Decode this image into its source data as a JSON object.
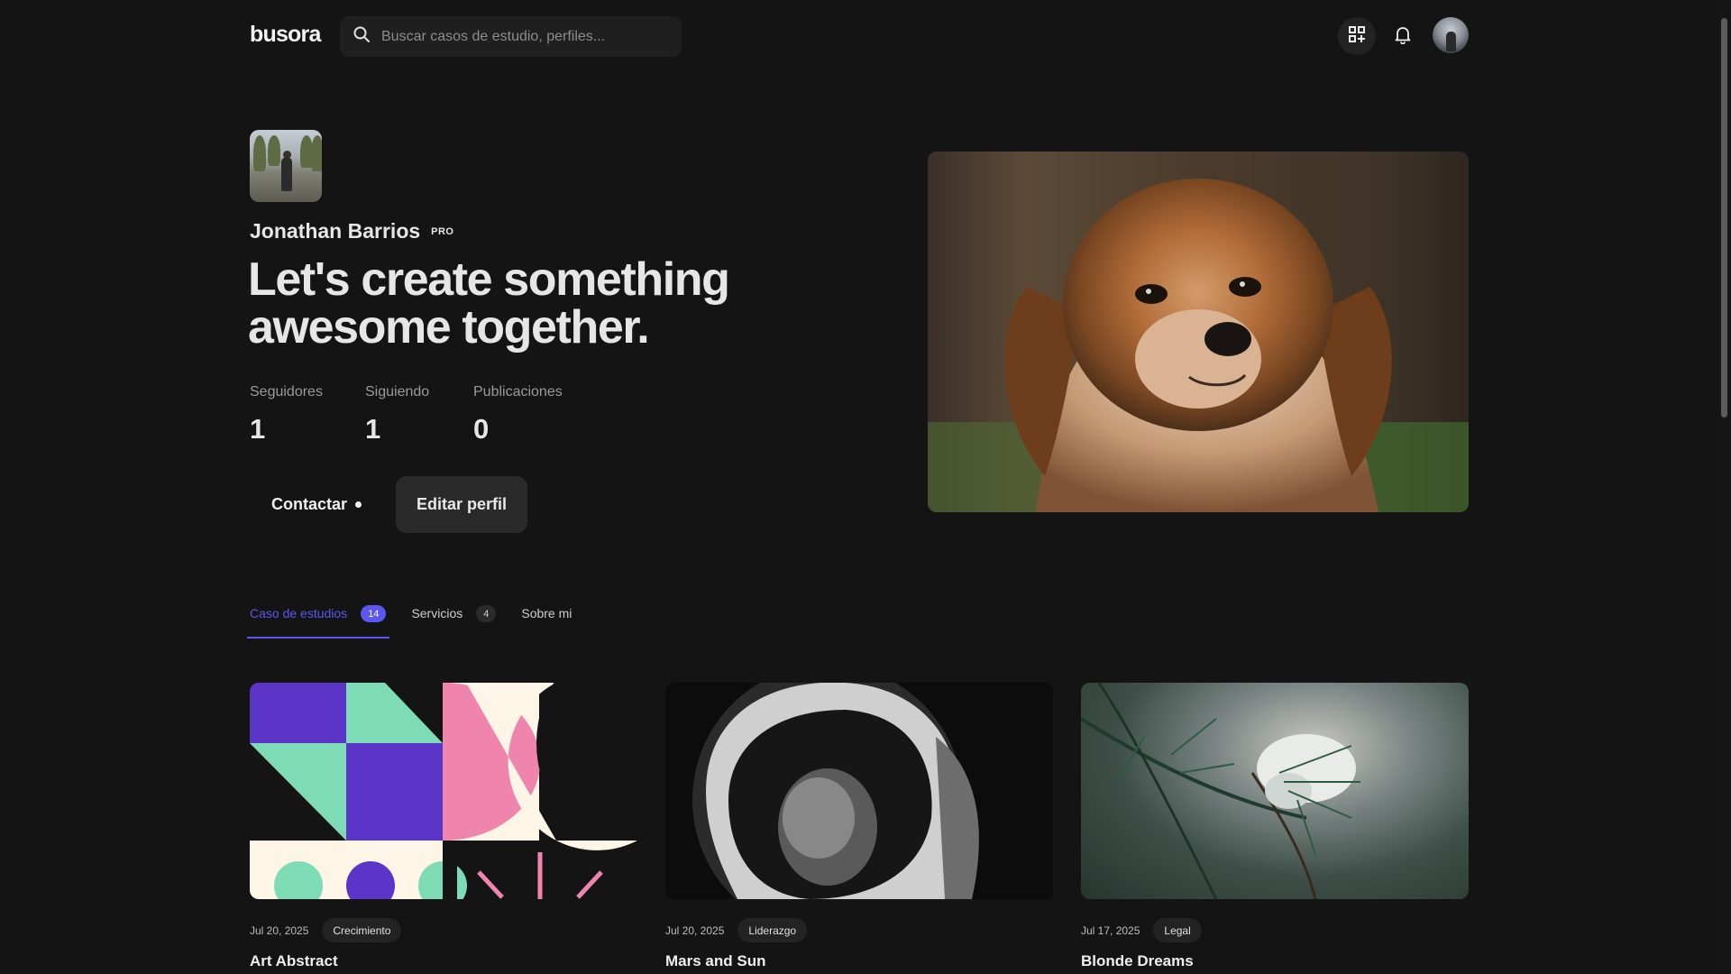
{
  "header": {
    "logo": "busora",
    "search_placeholder": "Buscar casos de estudio, perfiles...",
    "icons": [
      "search-icon",
      "apps-add-icon",
      "bell-icon",
      "user-avatar"
    ]
  },
  "profile": {
    "name": "Jonathan Barrios",
    "badge": "PRO",
    "headline": "Let's create something awesome together.",
    "stats": [
      {
        "label": "Seguidores",
        "value": "1"
      },
      {
        "label": "Siguiendo",
        "value": "1"
      },
      {
        "label": "Publicaciones",
        "value": "0"
      }
    ],
    "contact_label": "Contactar",
    "edit_label": "Editar perfil"
  },
  "tabs": [
    {
      "label": "Caso de estudios",
      "count": "14",
      "active": true
    },
    {
      "label": "Servicios",
      "count": "4",
      "active": false
    },
    {
      "label": "Sobre mi",
      "count": null,
      "active": false
    }
  ],
  "cards": [
    {
      "date": "Jul 20, 2025",
      "tag": "Crecimiento",
      "title": "Art Abstract"
    },
    {
      "date": "Jul 20, 2025",
      "tag": "Liderazgo",
      "title": "Mars and Sun"
    },
    {
      "date": "Jul 17, 2025",
      "tag": "Legal",
      "title": "Blonde Dreams"
    }
  ],
  "colors": {
    "background": "#141414",
    "accent": "#5b57f0",
    "art_purple": "#5a35c8",
    "art_mint": "#7ddcb5",
    "art_pink": "#ef85ad",
    "art_cream": "#fdf6e6"
  }
}
